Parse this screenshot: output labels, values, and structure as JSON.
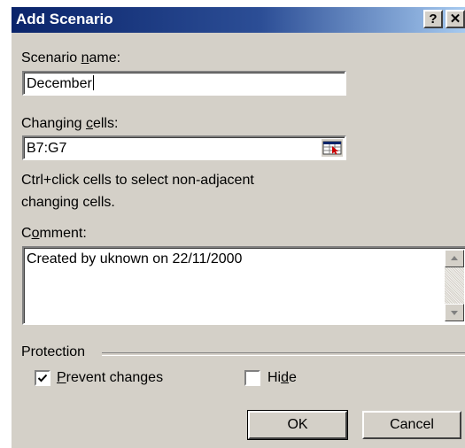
{
  "dialog": {
    "title": "Add Scenario",
    "help_button": "?",
    "close_button": "✕"
  },
  "scenario_name": {
    "label_pre": "Scenario ",
    "label_u": "n",
    "label_post": "ame:",
    "value": "December"
  },
  "changing_cells": {
    "label_pre": "Changing ",
    "label_u": "c",
    "label_post": "ells:",
    "value": "B7:G7",
    "hint_line1": "Ctrl+click cells to select non-adjacent",
    "hint_line2": "changing cells."
  },
  "comment": {
    "label_pre": "C",
    "label_u": "o",
    "label_post": "mment:",
    "value": "Created by uknown on 22/11/2000"
  },
  "protection": {
    "label": "Protection",
    "prevent_changes": {
      "label_u": "P",
      "label_post": "revent changes",
      "checked": true
    },
    "hide": {
      "label_pre": "Hi",
      "label_u": "d",
      "label_post": "e",
      "checked": false
    }
  },
  "buttons": {
    "ok": "OK",
    "cancel": "Cancel"
  }
}
